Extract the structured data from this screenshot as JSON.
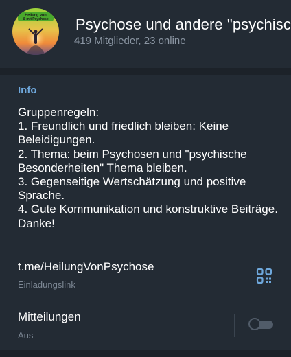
{
  "group": {
    "title": "Psychose und andere \"psychisc",
    "members": "419 Mitglieder, 23 online",
    "avatar_text_line1": "Heilung von",
    "avatar_text_line2": "& mit Psychose"
  },
  "info": {
    "heading": "Info",
    "description": "Gruppenregeln:\n1. Freundlich und friedlich bleiben: Keine Beleidigungen.\n2. Thema: beim Psychosen und \"psychische Besonderheiten\" Thema bleiben.\n3. Gegenseitige Wertschätzung und positive Sprache.\n4. Gute Kommunikation und konstruktive Beiträge.\nDanke!",
    "invite_link": "t.me/HeilungVonPsychose",
    "invite_link_label": "Einladungslink",
    "qr_icon": "qr-code-icon"
  },
  "notifications": {
    "label": "Mitteilungen",
    "status": "Aus",
    "enabled": false
  },
  "colors": {
    "background": "#1c2229",
    "card": "#232b34",
    "accent": "#6fa8dc",
    "secondary_text": "#8b96a3"
  }
}
